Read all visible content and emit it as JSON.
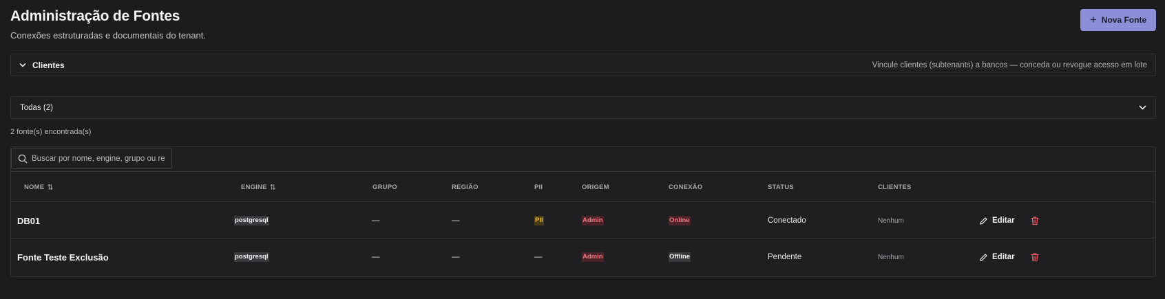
{
  "header": {
    "title": "Administração de Fontes",
    "subtitle": "Conexões estruturadas e documentais do tenant.",
    "new_button_label": "Nova Fonte"
  },
  "clients_section": {
    "title": "Clientes",
    "hint": "Vincule clientes (subtenants) a bancos — conceda ou revogue acesso em lote"
  },
  "filter": {
    "selected": "Todas (2)"
  },
  "results_count": "2 fonte(s) encontrada(s)",
  "search": {
    "placeholder": "Buscar por nome, engine, grupo ou região",
    "value": ""
  },
  "table": {
    "columns": {
      "name": "NOME",
      "engine": "ENGINE",
      "group": "GRUPO",
      "region": "REGIÃO",
      "pii": "PII",
      "origin": "ORIGEM",
      "connection": "CONEXÃO",
      "status": "STATUS",
      "clients": "CLIENTES"
    },
    "rows": [
      {
        "name": "DB01",
        "engine": "postgresql",
        "group": "—",
        "region": "—",
        "pii": "PII",
        "origin": "Admin",
        "connection": "Online",
        "status": "Conectado",
        "clients": "Nenhum",
        "edit_label": "Editar"
      },
      {
        "name": "Fonte Teste Exclusão",
        "engine": "postgresql",
        "group": "—",
        "region": "—",
        "pii": "—",
        "origin": "Admin",
        "connection": "Offline",
        "status": "Pendente",
        "clients": "Nenhum",
        "edit_label": "Editar"
      }
    ]
  },
  "colors": {
    "background": "#1c1c1e",
    "accent_button": "#8b8fd8",
    "danger": "#e05a64",
    "pii_tag": "#e8b838"
  }
}
